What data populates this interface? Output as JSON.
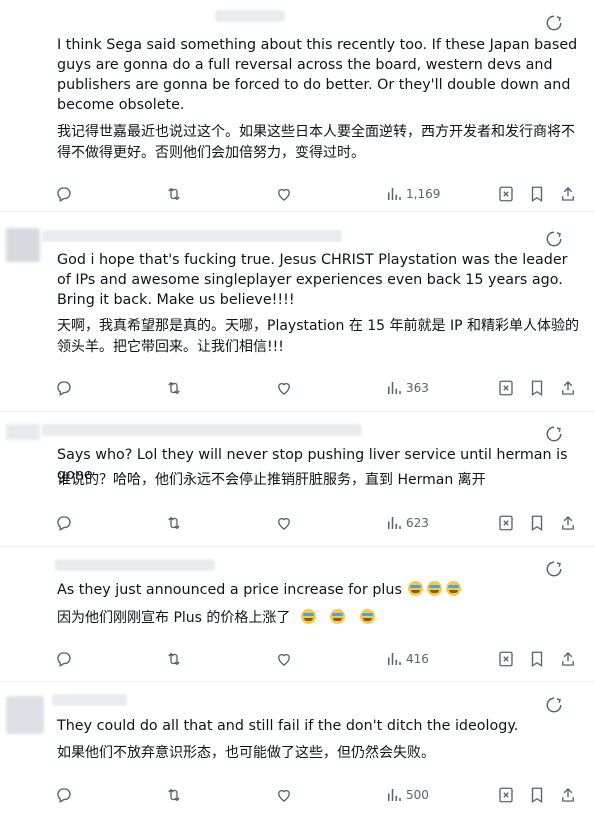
{
  "replies": [
    {
      "text_en": "I think Sega said something about this recently too. If these Japan based guys are gonna do a full reversal across the board, western devs and publishers are gonna be forced to do better. Or they'll double down and become obsolete.",
      "text_zh": "我记得世嘉最近也说过这个。如果这些日本人要全面逆转，西方开发者和发行商将不得不做得更好。否则他们会加倍努力，变得过时。",
      "views": "1,169"
    },
    {
      "text_en": "God i hope that's fucking true. Jesus CHRIST Playstation was the leader of IPs and awesome singleplayer experiences even back 15 years ago. Bring it back. Make us believe!!!!",
      "text_zh": "天啊，我真希望那是真的。天哪，Playstation 在 15 年前就是 IP 和精彩单人体验的领头羊。把它带回来。让我们相信!!!",
      "views": "363"
    },
    {
      "text_en": "Says who? Lol they will never stop pushing liver service until herman is gone",
      "text_zh": "谁说的？哈哈，他们永远不会停止推销肝脏服务，直到 Herman 离开",
      "views": "623"
    },
    {
      "text_en": "As they just announced a price increase for plus",
      "text_zh": "因为他们刚刚宣布 Plus 的价格上涨了",
      "views": "416"
    },
    {
      "text_en": "They could do all that and still fail if the don't ditch the ideology.",
      "text_zh": "如果他们不放弃意识形态，也可能做了这些，但仍然会失败。",
      "views": "500"
    }
  ],
  "icons": [
    "more-icon",
    "reply-icon",
    "retweet-icon",
    "like-icon",
    "views-icon",
    "grok-icon",
    "bookmark-icon",
    "share-icon"
  ],
  "colors": {
    "text": "#0f1419",
    "muted": "#536471",
    "divider": "#eff3f4"
  }
}
